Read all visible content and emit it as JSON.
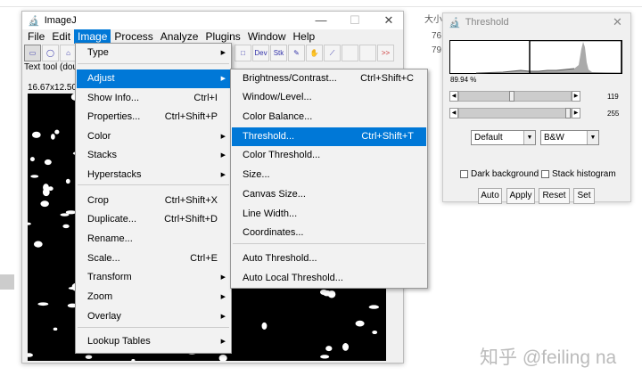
{
  "background": {
    "col_header": "大小",
    "values": [
      "76",
      "79"
    ],
    "watermark": "知乎 @feiling na"
  },
  "imagej": {
    "title": "ImageJ",
    "menubar": [
      "File",
      "Edit",
      "Image",
      "Process",
      "Analyze",
      "Plugins",
      "Window",
      "Help"
    ],
    "toolbar": {
      "dev": "Dev",
      "stk": "Stk",
      "more": ">>"
    },
    "status": "Text tool (dou",
    "image_info": "16.67x12.50"
  },
  "image_menu": [
    {
      "label": "Type",
      "arrow": true
    },
    {
      "label": "Adjust",
      "arrow": true,
      "highlighted": true
    },
    {
      "label": "Show Info...",
      "shortcut": "Ctrl+I"
    },
    {
      "label": "Properties...",
      "shortcut": "Ctrl+Shift+P"
    },
    {
      "label": "Color",
      "arrow": true
    },
    {
      "label": "Stacks",
      "arrow": true
    },
    {
      "label": "Hyperstacks",
      "arrow": true
    },
    {
      "label": "Crop",
      "shortcut": "Ctrl+Shift+X"
    },
    {
      "label": "Duplicate...",
      "shortcut": "Ctrl+Shift+D"
    },
    {
      "label": "Rename..."
    },
    {
      "label": "Scale...",
      "shortcut": "Ctrl+E"
    },
    {
      "label": "Transform",
      "arrow": true
    },
    {
      "label": "Zoom",
      "arrow": true
    },
    {
      "label": "Overlay",
      "arrow": true
    },
    {
      "label": "Lookup Tables",
      "arrow": true
    }
  ],
  "adjust_menu": [
    {
      "label": "Brightness/Contrast...",
      "shortcut": "Ctrl+Shift+C"
    },
    {
      "label": "Window/Level..."
    },
    {
      "label": "Color Balance..."
    },
    {
      "label": "Threshold...",
      "shortcut": "Ctrl+Shift+T",
      "highlighted": true
    },
    {
      "label": "Color Threshold..."
    },
    {
      "label": "Size..."
    },
    {
      "label": "Canvas Size..."
    },
    {
      "label": "Line Width..."
    },
    {
      "label": "Coordinates..."
    },
    {
      "label": "Auto Threshold..."
    },
    {
      "label": "Auto Local Threshold..."
    }
  ],
  "threshold": {
    "title": "Threshold",
    "percent": "89.94 %",
    "min_value": "119",
    "max_value": "255",
    "min_fraction": 0.467,
    "max_fraction": 1.0,
    "method": "Default",
    "display": "B&W",
    "dark_background": "Dark background",
    "stack_histogram": "Stack histogram",
    "buttons": [
      "Auto",
      "Apply",
      "Reset",
      "Set"
    ]
  },
  "colors": {
    "highlight": "#0078d7"
  }
}
